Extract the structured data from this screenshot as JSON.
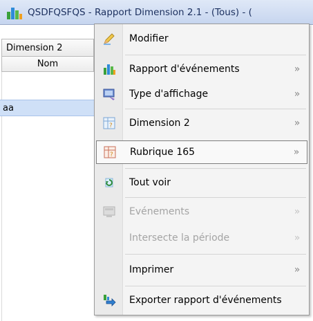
{
  "window": {
    "title": "QSDFQSFQS - Rapport Dimension 2.1 - (Tous) - ("
  },
  "grid": {
    "column_header": "Dimension 2",
    "sub_header": "Nom",
    "selected_row": "aa"
  },
  "menu": {
    "items": [
      {
        "label": "Modifier",
        "icon": "pencil-icon",
        "submenu": false,
        "disabled": false
      },
      {
        "label": "Rapport d'événements",
        "icon": "bar-chart-icon",
        "submenu": true,
        "disabled": false
      },
      {
        "label": "Type d'affichage",
        "icon": "display-type-icon",
        "submenu": true,
        "disabled": false
      },
      {
        "label": "Dimension 2",
        "icon": "dimension-icon",
        "submenu": true,
        "disabled": false
      },
      {
        "label": "Rubrique 165",
        "icon": "rubrique-icon",
        "submenu": true,
        "disabled": false
      },
      {
        "label": "Tout voir",
        "icon": "view-all-icon",
        "submenu": false,
        "disabled": false
      },
      {
        "label": "Evénements",
        "icon": "events-icon",
        "submenu": true,
        "disabled": true
      },
      {
        "label": "Intersecte la période",
        "icon": "",
        "submenu": true,
        "disabled": true
      },
      {
        "label": "Imprimer",
        "icon": "",
        "submenu": true,
        "disabled": false
      },
      {
        "label": "Exporter rapport d'événements",
        "icon": "export-icon",
        "submenu": false,
        "disabled": false
      }
    ],
    "submenu_arrow": "»"
  },
  "colors": {
    "title_text": "#1b2f5e",
    "selected_row_bg": "#cfe0f7",
    "menu_bg": "#f4f4f4",
    "disabled_text": "#a4a4a4"
  }
}
